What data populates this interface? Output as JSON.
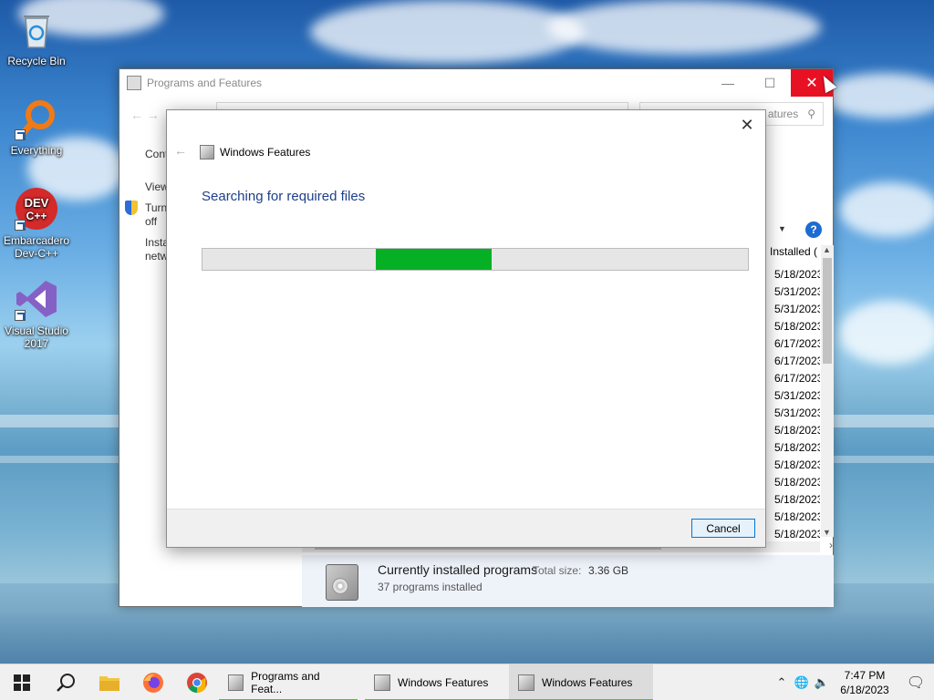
{
  "desktop": {
    "icons": [
      {
        "label": "Recycle Bin",
        "icon": "recycle-bin-icon"
      },
      {
        "label": "Everything",
        "icon": "everything-search-icon"
      },
      {
        "label": "Embarcadero Dev-C++",
        "icon": "dev-cpp-icon"
      },
      {
        "label": "Visual Studio 2017",
        "icon": "visual-studio-icon"
      }
    ]
  },
  "programs_window": {
    "title": "Programs and Features",
    "search_placeholder": "atures",
    "left_pane": {
      "control_panel_link": "Cont",
      "view_link": "View",
      "turn_features_line1": "Turn",
      "turn_features_line2": "off",
      "install_line1": "Insta",
      "install_line2": "netw"
    },
    "list_header_installed": "Installed (",
    "installed_dates": [
      "5/18/2023",
      "5/31/2023",
      "5/31/2023",
      "5/18/2023",
      "6/17/2023",
      "6/17/2023",
      "6/17/2023",
      "5/31/2023",
      "5/31/2023",
      "5/18/2023",
      "5/18/2023",
      "5/18/2023",
      "5/18/2023",
      "5/18/2023",
      "5/18/2023",
      "5/18/2023"
    ],
    "details": {
      "title": "Currently installed programs",
      "total_size_label": "Total size:",
      "total_size_value": "3.36 GB",
      "program_count": "37 programs installed"
    },
    "help_symbol": "?"
  },
  "features_dialog": {
    "title": "Windows Features",
    "status": "Searching for required files",
    "progress_indicator": {
      "segment_start": 0.318,
      "segment_end": 0.53,
      "mode": "indeterminate"
    },
    "cancel_label": "Cancel",
    "progress_color": "#06b025"
  },
  "taskbar": {
    "apps": [
      {
        "label": "Programs and Feat...",
        "icon": "programs-features-icon"
      },
      {
        "label": "Windows Features",
        "icon": "windows-features-icon"
      },
      {
        "label": "Windows Features",
        "icon": "windows-features-icon"
      }
    ],
    "time": "7:47 PM",
    "date": "6/18/2023"
  },
  "accent_colors": {
    "close_red": "#e81123",
    "link_blue": "#1d3f8a",
    "task_underline": "#6bb14f"
  }
}
